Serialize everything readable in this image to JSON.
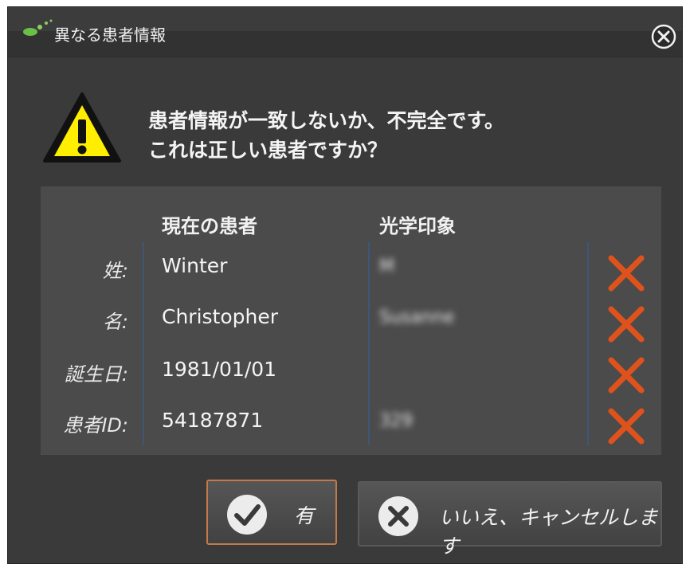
{
  "dialog": {
    "title": "異なる患者情報",
    "message_line1": "患者情報が一致しないか、不完全です。",
    "message_line2": "これは正しい患者ですか？"
  },
  "table": {
    "header_current": "現在の患者",
    "header_optical": "光学印象",
    "rows": [
      {
        "label": "姓:",
        "current": "Winter",
        "optical": "M"
      },
      {
        "label": "名:",
        "current": "Christopher",
        "optical": "Susanne"
      },
      {
        "label": "誕生日:",
        "current": "1981/01/01",
        "optical": ""
      },
      {
        "label": "患者ID:",
        "current": "54187871",
        "optical": "329"
      }
    ]
  },
  "buttons": {
    "yes_label": "有",
    "no_label": "いいえ、キャンセルします"
  },
  "colors": {
    "mismatch_x": "#e0521c",
    "primary_border": "#c27a4a",
    "divider": "#3e5677",
    "warning_yellow": "#ffee00"
  }
}
